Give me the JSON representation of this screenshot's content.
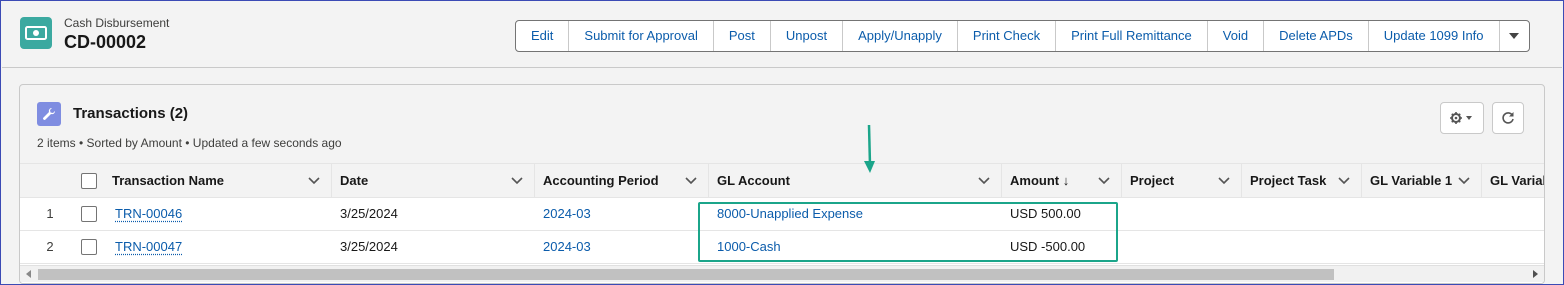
{
  "header": {
    "object_label": "Cash Disbursement",
    "record_name": "CD-00002",
    "actions": [
      "Edit",
      "Submit for Approval",
      "Post",
      "Unpost",
      "Apply/Unapply",
      "Print Check",
      "Print Full Remittance",
      "Void",
      "Delete APDs",
      "Update 1099 Info"
    ],
    "more_icon": "chevron-down-icon",
    "icon": "money-icon",
    "icon_color": "#3ba9a0"
  },
  "related_list": {
    "title": "Transactions (2)",
    "meta": "2 items • Sorted by Amount • Updated a few seconds ago",
    "icon": "wrench-icon",
    "icon_color": "#7f8de1",
    "settings_icon": "gear-icon",
    "refresh_icon": "refresh-icon",
    "columns": [
      "Transaction Name",
      "Date",
      "Accounting Period",
      "GL Account",
      "Amount ↓",
      "Project",
      "Project Task",
      "GL Variable 1",
      "GL Variab"
    ],
    "rows": [
      {
        "num": "1",
        "name": "TRN-00046",
        "date": "3/25/2024",
        "period": "2024-03",
        "gl_account": "8000-Unapplied Expense",
        "amount": "USD 500.00"
      },
      {
        "num": "2",
        "name": "TRN-00047",
        "date": "3/25/2024",
        "period": "2024-03",
        "gl_account": "1000-Cash",
        "amount": "USD -500.00"
      }
    ]
  },
  "annotation": {
    "color": "#1ba58a"
  }
}
